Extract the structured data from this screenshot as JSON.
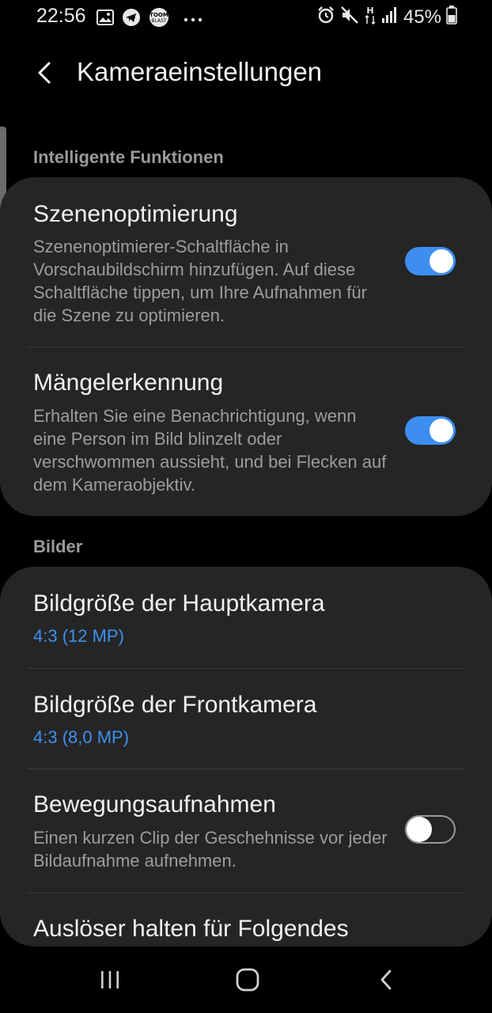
{
  "status_bar": {
    "time": "22:56",
    "battery_percent": "45%",
    "icons_left": [
      "gallery-icon",
      "telegram-icon",
      "toom-blast-icon",
      "more-dots-icon"
    ],
    "icons_right": [
      "alarm-icon",
      "mute-icon",
      "h-data-icon",
      "signal-icon",
      "battery-icon"
    ],
    "toom_label": "TOOM\nBLAST"
  },
  "header": {
    "title": "Kameraeinstellungen"
  },
  "sections": [
    {
      "title": "Intelligente Funktionen",
      "items": [
        {
          "title": "Szenenoptimierung",
          "description": "Szenenoptimierer-Schaltfläche in Vorschaubildschirm hinzufügen. Auf diese Schaltfläche tippen, um Ihre Aufnahmen für die Szene zu optimieren.",
          "toggle": true
        },
        {
          "title": "Mängelerkennung",
          "description": "Erhalten Sie eine Benachrichtigung, wenn eine Person im Bild blinzelt oder verschwommen aussieht, und bei Flecken auf dem Kameraobjektiv.",
          "toggle": true
        }
      ]
    },
    {
      "title": "Bilder",
      "items": [
        {
          "title": "Bildgröße der Hauptkamera",
          "value": "4:3 (12 MP)"
        },
        {
          "title": "Bildgröße der Frontkamera",
          "value": "4:3 (8,0 MP)"
        },
        {
          "title": "Bewegungsaufnahmen",
          "description": "Einen kurzen Clip der Geschehnisse vor jeder Bildaufnahme aufnehmen.",
          "toggle": false
        },
        {
          "title": "Auslöser halten für Folgendes"
        }
      ]
    }
  ],
  "nav_bar": {
    "buttons": [
      "recents-icon",
      "home-icon",
      "back-icon"
    ]
  },
  "colors": {
    "background": "#000000",
    "card": "#252525",
    "accent": "#3e8ef0",
    "secondary_text": "#9d9d9d",
    "section_header": "#9a9a9a"
  }
}
